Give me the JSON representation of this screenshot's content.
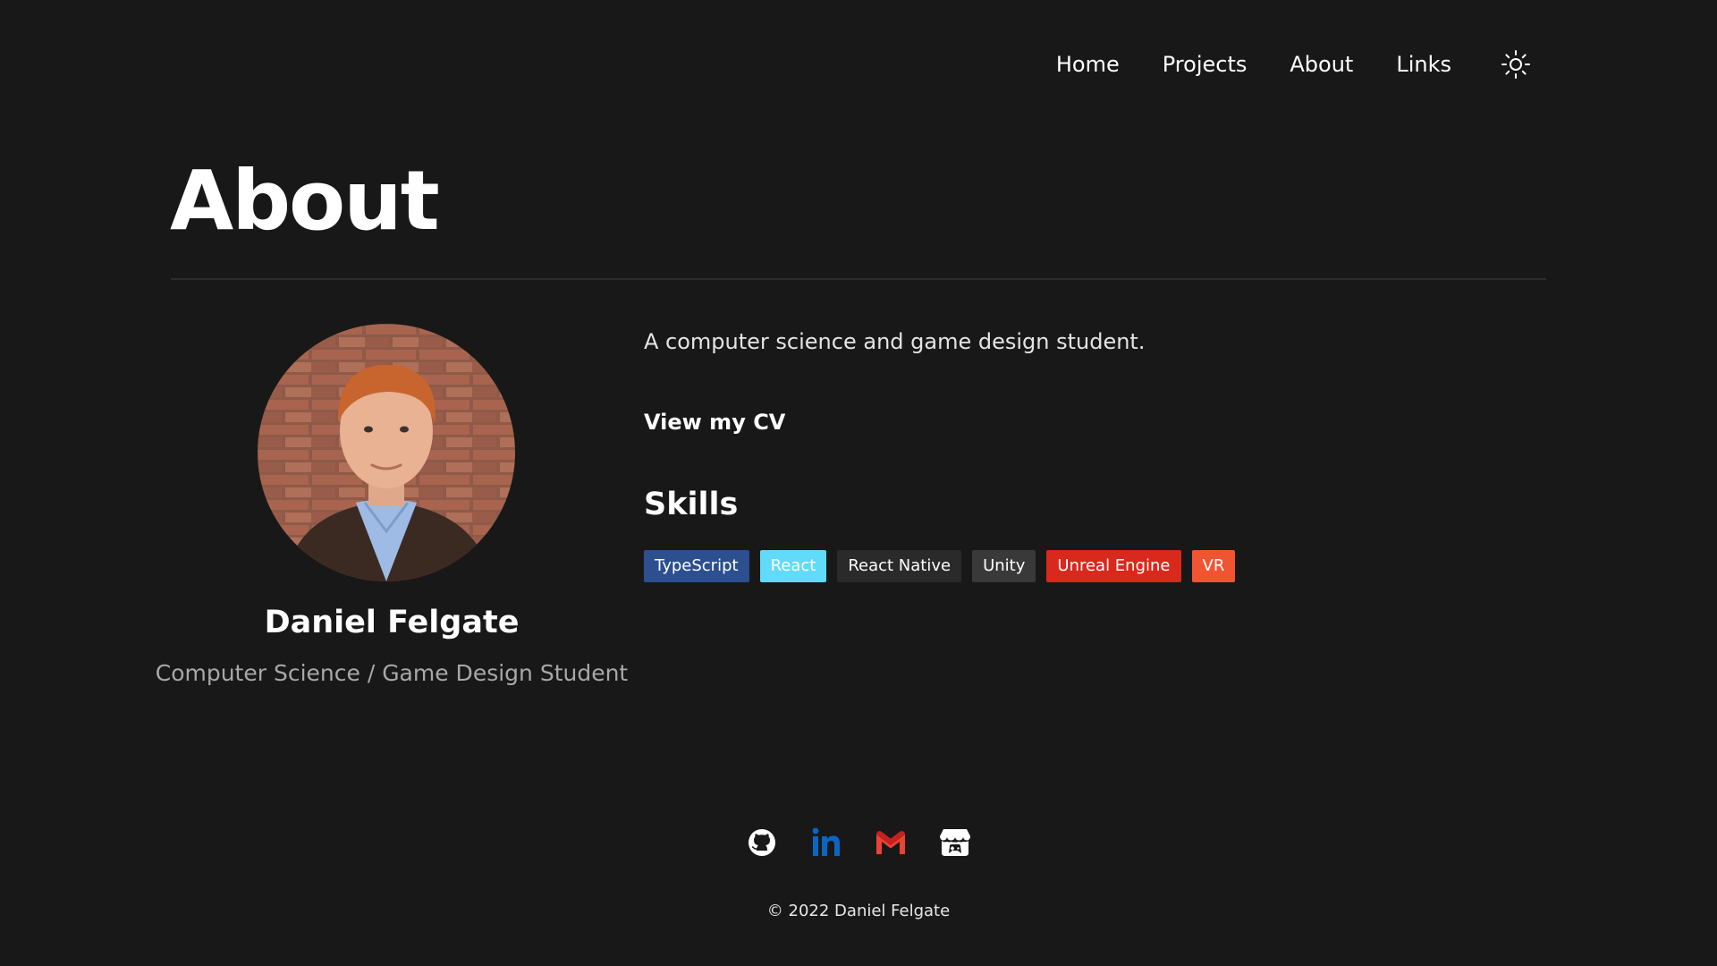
{
  "nav": {
    "items": [
      {
        "label": "Home"
      },
      {
        "label": "Projects"
      },
      {
        "label": "About"
      },
      {
        "label": "Links"
      }
    ],
    "theme_toggle_icon": "sun-icon"
  },
  "page": {
    "title": "About"
  },
  "profile": {
    "name": "Daniel Felgate",
    "role": "Computer Science / Game Design Student",
    "avatar_icon": "profile-photo"
  },
  "bio": {
    "text": "A computer science and game design student.",
    "cv_link": "View my CV"
  },
  "skills": {
    "heading": "Skills",
    "items": [
      {
        "label": "TypeScript",
        "color": "#2b4f8f"
      },
      {
        "label": "React",
        "color": "#61dafb"
      },
      {
        "label": "React Native",
        "color": "#2a2a2a"
      },
      {
        "label": "Unity",
        "color": "#393939"
      },
      {
        "label": "Unreal Engine",
        "color": "#d9281c"
      },
      {
        "label": "VR",
        "color": "#f05432"
      }
    ]
  },
  "footer": {
    "socials": [
      {
        "icon": "github-icon"
      },
      {
        "icon": "linkedin-icon",
        "color": "#0a66c2"
      },
      {
        "icon": "gmail-icon",
        "color": "#ea4335"
      },
      {
        "icon": "itchio-icon"
      }
    ],
    "copyright": "© 2022 Daniel Felgate"
  }
}
